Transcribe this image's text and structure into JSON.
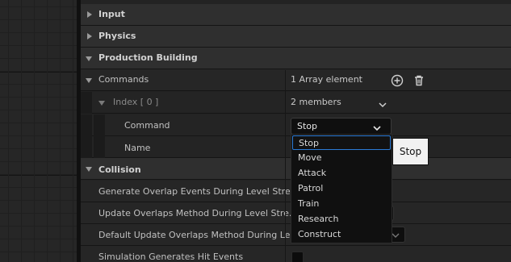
{
  "categories": {
    "input": "Input",
    "physics": "Physics",
    "production": "Production Building",
    "collision": "Collision"
  },
  "commands": {
    "label": "Commands",
    "value": "1 Array element",
    "add_icon": "add-circle-icon",
    "delete_icon": "trash-icon"
  },
  "index_row": {
    "label": "Index [ 0 ]",
    "value": "2 members"
  },
  "command_row": {
    "label": "Command",
    "selected": "Stop"
  },
  "name_row": {
    "label": "Name"
  },
  "tooltip_preview": "Stop",
  "dropdown_options": [
    "Stop",
    "Move",
    "Attack",
    "Patrol",
    "Train",
    "Research",
    "Construct"
  ],
  "collision_rows": [
    "Generate Overlap Events During Level Stre...",
    "Update Overlaps Method During Level Stre...",
    "Default Update Overlaps Method During Le...",
    "Simulation Generates Hit Events"
  ],
  "colors": {
    "accent": "#2b7bd6",
    "panel": "#232323",
    "category": "#2f2f2f"
  }
}
